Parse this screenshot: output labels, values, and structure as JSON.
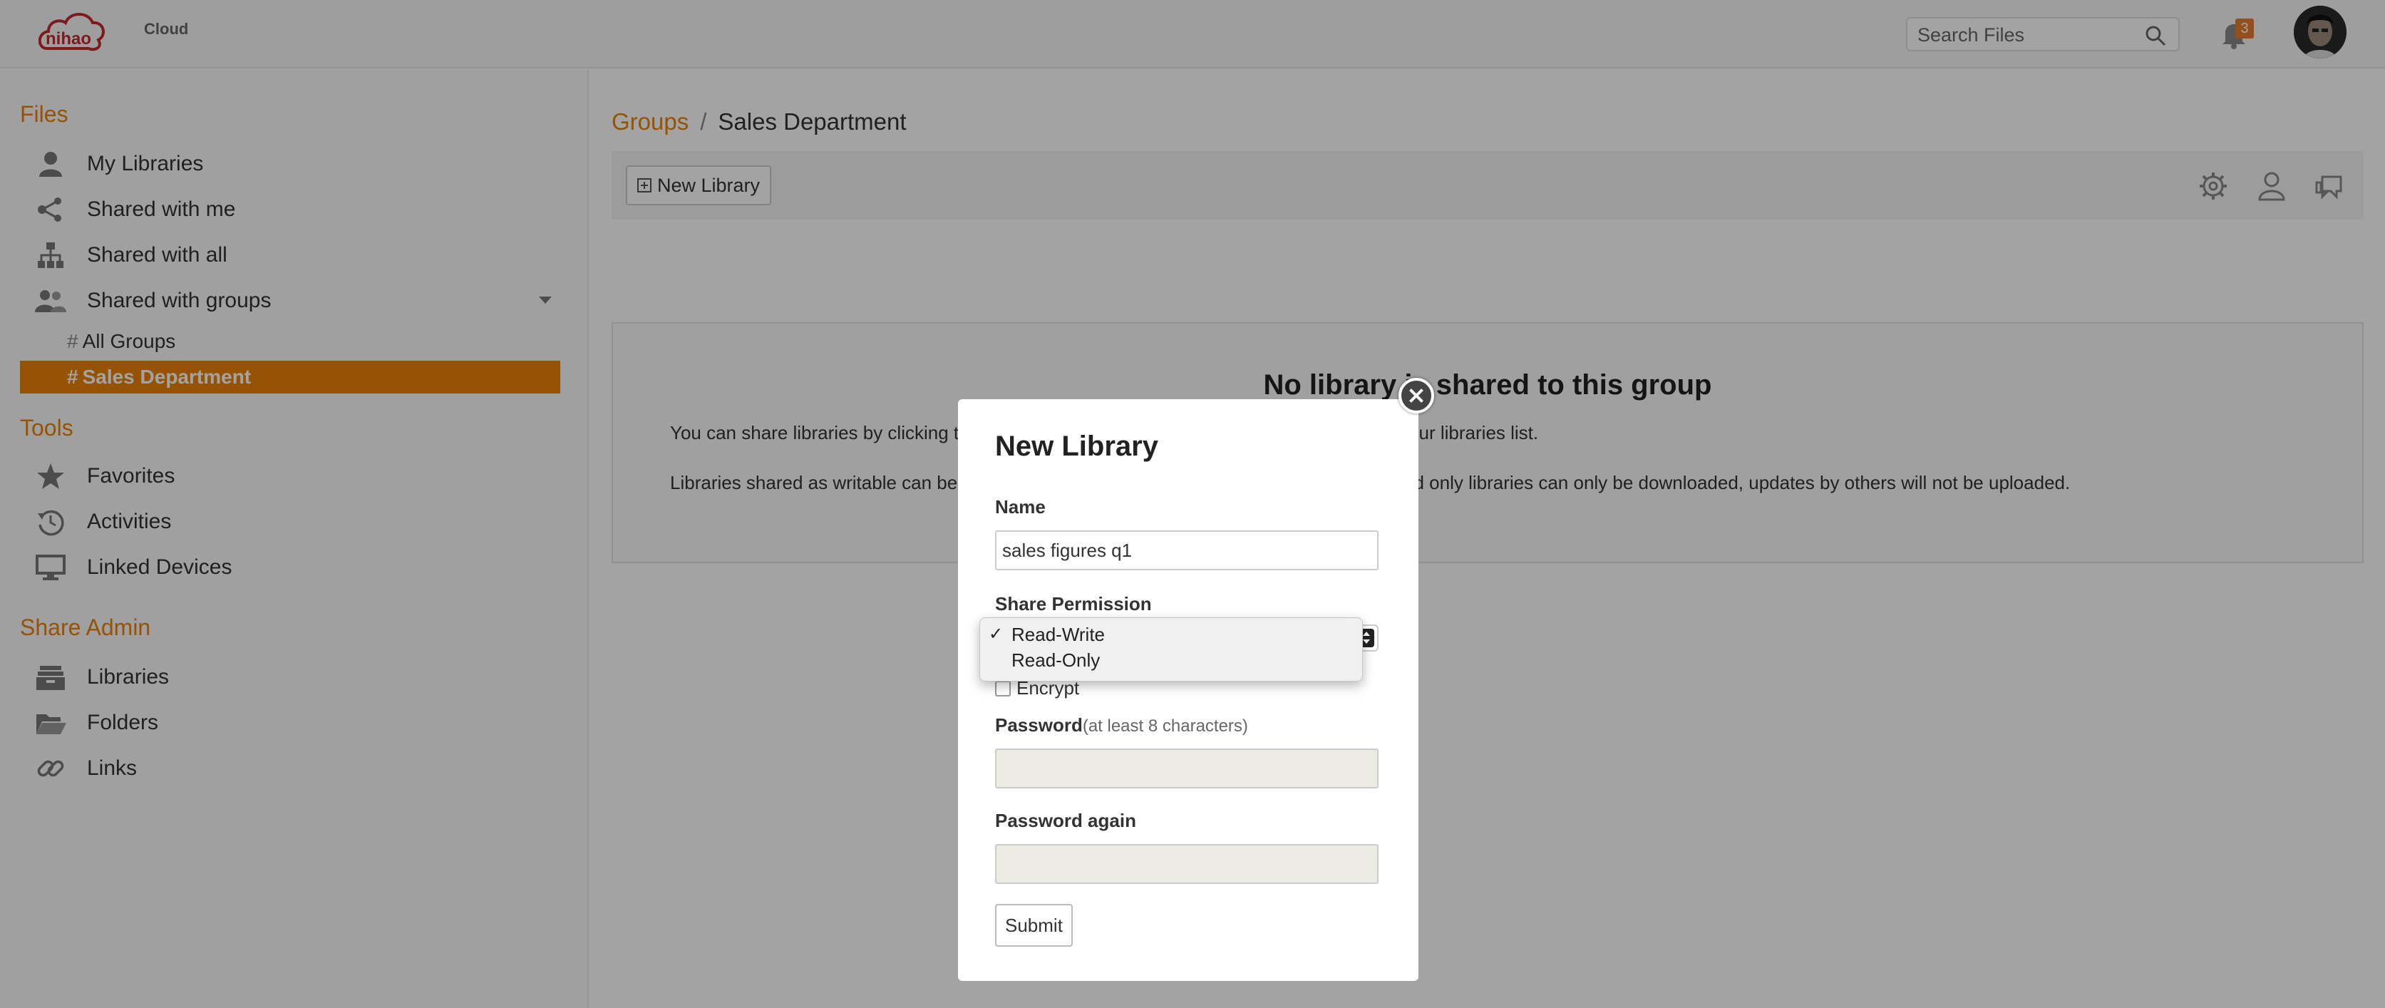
{
  "header": {
    "logo_text": "nihao",
    "logo_suffix": "Cloud",
    "search_placeholder": "Search Files",
    "notification_count": "3"
  },
  "sidebar": {
    "files_heading": "Files",
    "files_items": [
      {
        "label": "My Libraries",
        "icon": "user-icon"
      },
      {
        "label": "Shared with me",
        "icon": "share-icon"
      },
      {
        "label": "Shared with all",
        "icon": "org-tree-icon"
      },
      {
        "label": "Shared with groups",
        "icon": "group-icon"
      }
    ],
    "groups_sub": [
      {
        "hash": "#",
        "label": "All Groups"
      },
      {
        "hash": "#",
        "label": "Sales Department"
      }
    ],
    "tools_heading": "Tools",
    "tools_items": [
      {
        "label": "Favorites",
        "icon": "star-icon"
      },
      {
        "label": "Activities",
        "icon": "history-icon"
      },
      {
        "label": "Linked Devices",
        "icon": "monitor-icon"
      }
    ],
    "admin_heading": "Share Admin",
    "admin_items": [
      {
        "label": "Libraries",
        "icon": "archive-icon"
      },
      {
        "label": "Folders",
        "icon": "folder-icon"
      },
      {
        "label": "Links",
        "icon": "link-icon"
      }
    ]
  },
  "main": {
    "breadcrumb_link": "Groups",
    "breadcrumb_sep": "/",
    "breadcrumb_current": "Sales Department",
    "new_library_label": "New Library",
    "empty_title": "No library is shared to this group",
    "empty_p1": "You can share libraries by clicking the \"New Library\" button above or the \"Share\" icon on your libraries list.",
    "empty_p2": "Libraries shared as writable can be downloaded and synced by other group members. Read only libraries can only be downloaded, updates by others will not be uploaded."
  },
  "modal": {
    "title": "New Library",
    "name_label": "Name",
    "name_value": "sales figures q1",
    "permission_label": "Share Permission",
    "permission_options": [
      "Read-Write",
      "Read-Only"
    ],
    "permission_selected_mark": "✓",
    "encrypt_label": "Encrypt",
    "password_label": "Password",
    "password_hint": "(at least 8 characters)",
    "password_again_label": "Password again",
    "submit_label": "Submit"
  },
  "colors": {
    "accent": "#eb8205",
    "logo_red": "#c8282c"
  }
}
